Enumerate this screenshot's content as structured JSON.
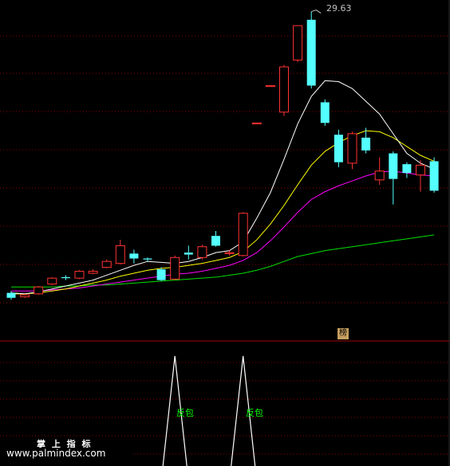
{
  "chart_data": {
    "type": "candlestick",
    "y_price_max": 29.63,
    "candles": [
      {
        "o": 0.5,
        "c": 1.0,
        "h": 1.2,
        "l": 0.3,
        "up": false
      },
      {
        "o": 0.6,
        "c": 0.8,
        "h": 0.9,
        "l": 0.5,
        "up": true
      },
      {
        "o": 0.9,
        "c": 1.6,
        "h": 1.7,
        "l": 0.8,
        "up": true
      },
      {
        "o": 1.9,
        "c": 2.5,
        "h": 2.6,
        "l": 1.8,
        "up": true
      },
      {
        "o": 2.5,
        "c": 2.6,
        "h": 2.8,
        "l": 2.3,
        "up": false
      },
      {
        "o": 2.5,
        "c": 3.2,
        "h": 3.3,
        "l": 2.4,
        "up": true
      },
      {
        "o": 3.0,
        "c": 3.2,
        "h": 3.4,
        "l": 2.9,
        "up": true
      },
      {
        "o": 3.6,
        "c": 4.2,
        "h": 4.4,
        "l": 3.5,
        "up": true
      },
      {
        "o": 4.0,
        "c": 5.8,
        "h": 6.4,
        "l": 3.9,
        "up": true
      },
      {
        "o": 5.0,
        "c": 4.5,
        "h": 5.4,
        "l": 4.0,
        "up": false
      },
      {
        "o": 4.5,
        "c": 4.4,
        "h": 4.6,
        "l": 4.2,
        "up": false
      },
      {
        "o": 3.4,
        "c": 2.3,
        "h": 3.6,
        "l": 2.2,
        "up": false
      },
      {
        "o": 2.4,
        "c": 4.6,
        "h": 4.8,
        "l": 2.3,
        "up": true
      },
      {
        "o": 4.9,
        "c": 5.1,
        "h": 5.8,
        "l": 4.4,
        "up": false
      },
      {
        "o": 4.6,
        "c": 5.7,
        "h": 5.9,
        "l": 4.4,
        "up": true
      },
      {
        "o": 5.8,
        "c": 6.8,
        "h": 7.3,
        "l": 5.7,
        "up": false
      },
      {
        "o": 5.0,
        "c": 5.1,
        "h": 5.3,
        "l": 4.8,
        "up": true
      },
      {
        "o": 4.8,
        "c": 9.1,
        "h": 9.2,
        "l": 4.7,
        "up": true
      },
      {
        "o": 18.2,
        "c": 18.3,
        "h": 18.3,
        "l": 18.2,
        "up": true
      },
      {
        "o": 22.0,
        "c": 22.1,
        "h": 22.1,
        "l": 22.0,
        "up": true
      },
      {
        "o": 19.4,
        "c": 24.0,
        "h": 24.2,
        "l": 19.0,
        "up": true
      },
      {
        "o": 24.7,
        "c": 28.2,
        "h": 28.2,
        "l": 24.5,
        "up": true
      },
      {
        "o": 28.8,
        "c": 22.1,
        "h": 29.63,
        "l": 21.8,
        "up": false
      },
      {
        "o": 20.4,
        "c": 18.3,
        "h": 20.7,
        "l": 18.0,
        "up": false
      },
      {
        "o": 17.1,
        "c": 14.3,
        "h": 17.6,
        "l": 13.8,
        "up": false
      },
      {
        "o": 14.2,
        "c": 17.2,
        "h": 17.4,
        "l": 13.6,
        "up": true
      },
      {
        "o": 16.8,
        "c": 15.5,
        "h": 17.8,
        "l": 15.2,
        "up": false
      },
      {
        "o": 12.5,
        "c": 13.4,
        "h": 14.8,
        "l": 12.0,
        "up": true
      },
      {
        "o": 15.2,
        "c": 12.6,
        "h": 15.4,
        "l": 10.0,
        "up": false
      },
      {
        "o": 14.1,
        "c": 13.2,
        "h": 14.3,
        "l": 12.7,
        "up": false
      },
      {
        "o": 13.0,
        "c": 14.0,
        "h": 14.5,
        "l": 11.3,
        "up": true
      },
      {
        "o": 14.4,
        "c": 11.4,
        "h": 14.8,
        "l": 11.2,
        "up": false
      }
    ],
    "ma_white": [
      1.0,
      0.9,
      1.1,
      1.4,
      1.7,
      2.0,
      2.3,
      2.8,
      3.3,
      3.8,
      4.2,
      4.1,
      4.0,
      4.2,
      4.6,
      5.1,
      5.3,
      6.2,
      8.6,
      11.2,
      14.6,
      18.2,
      21.0,
      22.6,
      22.5,
      21.8,
      20.5,
      19.2,
      17.2,
      15.2,
      14.2,
      13.6
    ],
    "ma_yellow": [
      0.9,
      0.9,
      1.0,
      1.2,
      1.4,
      1.7,
      2.0,
      2.3,
      2.7,
      3.0,
      3.3,
      3.5,
      3.6,
      3.8,
      4.0,
      4.3,
      4.6,
      5.2,
      6.4,
      8.0,
      9.9,
      12.0,
      14.0,
      15.4,
      16.3,
      17.0,
      17.5,
      17.4,
      16.8,
      15.9,
      15.0,
      14.4
    ],
    "ma_magenta": [
      1.2,
      1.2,
      1.2,
      1.3,
      1.4,
      1.5,
      1.7,
      1.9,
      2.1,
      2.3,
      2.5,
      2.7,
      2.9,
      3.0,
      3.2,
      3.5,
      3.8,
      4.3,
      5.1,
      6.3,
      7.7,
      9.2,
      10.5,
      11.3,
      11.9,
      12.4,
      12.9,
      13.3,
      13.4,
      13.2,
      13.0,
      12.9
    ],
    "ma_green": [
      1.6,
      1.6,
      1.6,
      1.6,
      1.7,
      1.7,
      1.8,
      1.8,
      1.9,
      2.0,
      2.1,
      2.2,
      2.3,
      2.4,
      2.5,
      2.6,
      2.8,
      3.0,
      3.3,
      3.7,
      4.2,
      4.7,
      5.0,
      5.3,
      5.5,
      5.7,
      5.9,
      6.1,
      6.3,
      6.5,
      6.7,
      6.9
    ],
    "top_price_label": "29.63",
    "badge_text": "榜",
    "signals": [
      {
        "index": 12,
        "label": "反包"
      },
      {
        "index": 17,
        "label": "反包"
      }
    ]
  },
  "watermark": {
    "title": "掌 上 指 标",
    "url": "www.palmindex.com"
  },
  "colors": {
    "up": "#ff3232",
    "down": "#54ffff",
    "ma_white": "#ffffff",
    "ma_yellow": "#ffff00",
    "ma_magenta": "#ff00ff",
    "ma_green": "#00e000",
    "grid": "#8b0000",
    "divider": "#a00000"
  }
}
